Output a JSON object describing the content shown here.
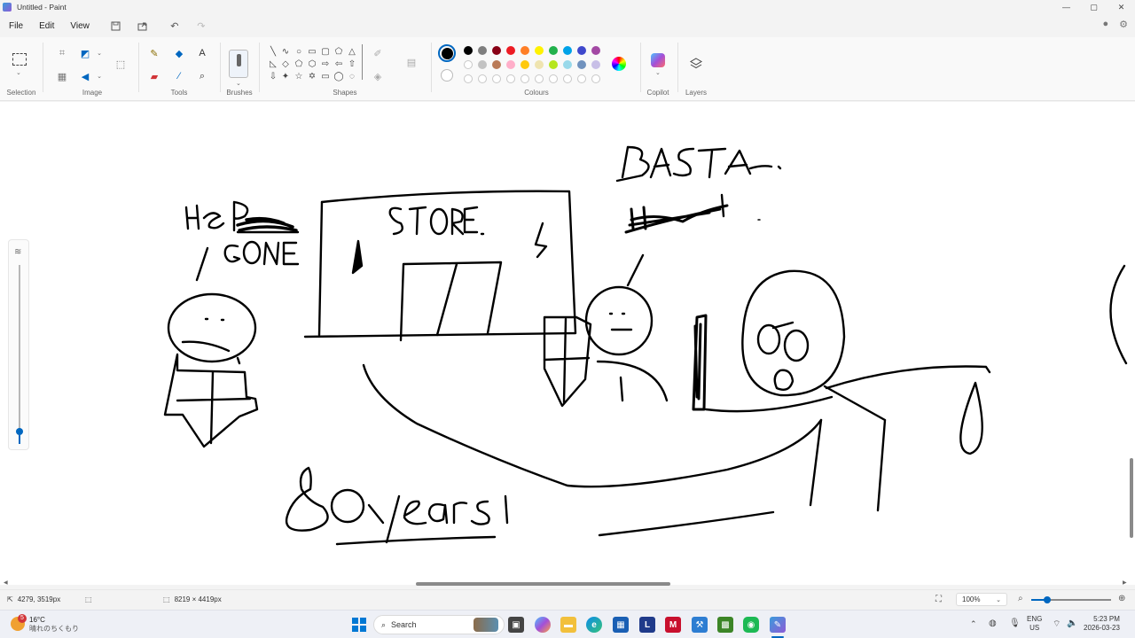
{
  "window": {
    "title": "Untitled - Paint",
    "minimize": "—",
    "maximize": "▢",
    "close": "✕"
  },
  "menu": [
    "File",
    "Edit",
    "View"
  ],
  "ribbon": {
    "groups": {
      "selection": "Selection",
      "image": "Image",
      "tools": "Tools",
      "brushes": "Brushes",
      "shapes": "Shapes",
      "colours": "Colours",
      "copilot": "Copilot",
      "layers": "Layers"
    },
    "palette_row1": [
      "#000000",
      "#7f7f7f",
      "#880015",
      "#ed1c24",
      "#ff7f27",
      "#fff200",
      "#22b14c",
      "#00a2e8",
      "#3f48cc",
      "#a349a4"
    ],
    "palette_row2": [
      "#ffffff",
      "#c3c3c3",
      "#b97a57",
      "#ffaec9",
      "#ffc90e",
      "#efe4b0",
      "#b5e61d",
      "#99d9ea",
      "#7092be",
      "#c8bfe7"
    ],
    "selected_color": "#000000",
    "secondary_color": "#ffffff"
  },
  "drawing": {
    "word_he": "He",
    "word_gone": "GONE",
    "word_store": "STORE",
    "word_basta": "BASTA.",
    "word_80": "80",
    "word_years": "years"
  },
  "status": {
    "cursor_position": "4279, 3519px",
    "canvas_size": "8219 × 4419px",
    "zoom": "100%"
  },
  "taskbar": {
    "weather_temp": "16°C",
    "weather_desc": "晴れのちくもり",
    "weather_badge": "5",
    "search_placeholder": "Search",
    "lang_top": "ENG",
    "lang_bottom": "US",
    "time": "5:23 PM",
    "date": "2026-03-23"
  }
}
